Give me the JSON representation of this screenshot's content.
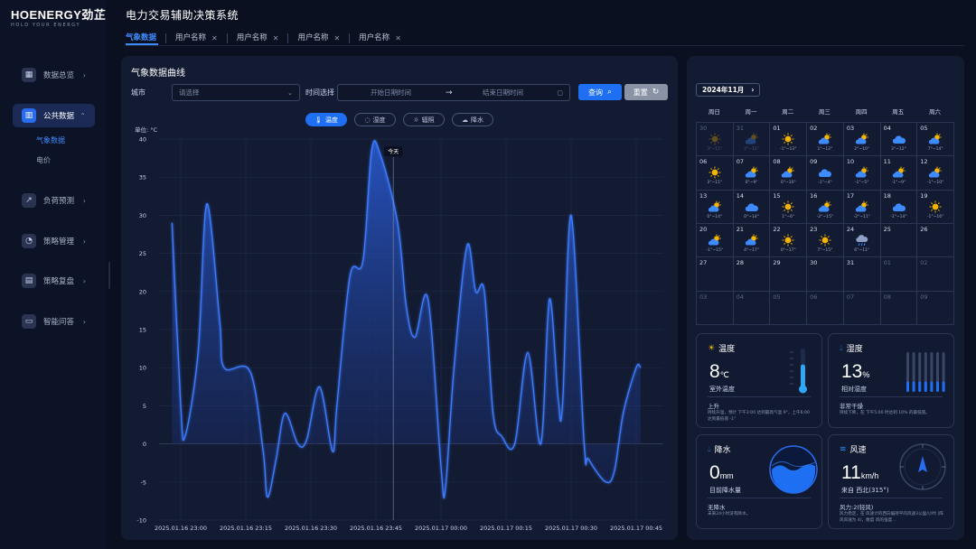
{
  "brand": {
    "name": "HOENERGY劲芷",
    "tagline": "HOLD YOUR ENERGY"
  },
  "app_title": "电力交易辅助决策系统",
  "sidebar": {
    "items": [
      {
        "label": "数据总览",
        "icon": "dashboard-icon",
        "chevron": "›"
      },
      {
        "label": "公共数据",
        "icon": "bar-chart-icon",
        "chevron": "⌃",
        "active": true,
        "children": [
          {
            "label": "气象数据",
            "active": true
          },
          {
            "label": "电价"
          }
        ]
      },
      {
        "label": "负荷预测",
        "icon": "trend-icon",
        "chevron": "›"
      },
      {
        "label": "策略管理",
        "icon": "pie-icon",
        "chevron": "›"
      },
      {
        "label": "策略复盘",
        "icon": "document-icon",
        "chevron": "›"
      },
      {
        "label": "智能问答",
        "icon": "chat-icon",
        "chevron": "›"
      }
    ]
  },
  "tabs": [
    {
      "label": "气象数据",
      "closable": false
    },
    {
      "label": "用户名称",
      "closable": true
    },
    {
      "label": "用户名称",
      "closable": true
    },
    {
      "label": "用户名称",
      "closable": true
    },
    {
      "label": "用户名称",
      "closable": true
    }
  ],
  "chart_panel": {
    "title": "气象数据曲线",
    "city_label": "城市",
    "city_placeholder": "请选择",
    "time_label": "时间选择",
    "start_placeholder": "开始日期时间",
    "end_placeholder": "结束日期时间",
    "query_label": "查询",
    "reset_label": "重置",
    "toggles": [
      {
        "label": "温度",
        "active": true
      },
      {
        "label": "湿度",
        "active": false
      },
      {
        "label": "辐照",
        "active": false
      },
      {
        "label": "降水",
        "active": false
      }
    ]
  },
  "chart_data": {
    "type": "area",
    "unit_label": "单位: °C",
    "ylim": [
      -10,
      40
    ],
    "y_ticks": [
      -10,
      -5,
      0,
      5,
      10,
      15,
      20,
      25,
      30,
      35,
      40
    ],
    "x_tick_labels": [
      "2025.01.16 23:00",
      "2025.01.16 23:15",
      "2025.01.16 23:30",
      "2025.01.16 23:45",
      "2025.01.17 00:00",
      "2025.01.17 00:15",
      "2025.01.17 00:30",
      "2025.01.17 00:45"
    ],
    "today_marker": {
      "label": "今天",
      "x": "2025.01.16 23:49"
    },
    "series": [
      {
        "values": [
          [
            "2025.01.16 22:58",
            29
          ],
          [
            "2025.01.16 23:00",
            5
          ],
          [
            "2025.01.16 23:01",
            1
          ],
          [
            "2025.01.16 23:04",
            12
          ],
          [
            "2025.01.16 23:06",
            31.5
          ],
          [
            "2025.01.16 23:09",
            16
          ],
          [
            "2025.01.16 23:10",
            10
          ],
          [
            "2025.01.16 23:16",
            9.5
          ],
          [
            "2025.01.16 23:19",
            -1
          ],
          [
            "2025.01.16 23:20",
            -7
          ],
          [
            "2025.01.16 23:22",
            -2
          ],
          [
            "2025.01.16 23:24",
            4
          ],
          [
            "2025.01.16 23:27",
            0
          ],
          [
            "2025.01.16 23:29",
            0.5
          ],
          [
            "2025.01.16 23:32",
            7.5
          ],
          [
            "2025.01.16 23:35",
            -1
          ],
          [
            "2025.01.16 23:36",
            5
          ],
          [
            "2025.01.16 23:39",
            22
          ],
          [
            "2025.01.16 23:42",
            24
          ],
          [
            "2025.01.16 23:44",
            38.5
          ],
          [
            "2025.01.16 23:46",
            38
          ],
          [
            "2025.01.16 23:50",
            29
          ],
          [
            "2025.01.16 23:52",
            18
          ],
          [
            "2025.01.16 23:54",
            14
          ],
          [
            "2025.01.16 23:57",
            19
          ],
          [
            "2025.01.17 00:00",
            -3
          ],
          [
            "2025.01.17 00:01",
            -6
          ],
          [
            "2025.01.17 00:03",
            10
          ],
          [
            "2025.01.17 00:06",
            26
          ],
          [
            "2025.01.17 00:08",
            20
          ],
          [
            "2025.01.17 00:10",
            20
          ],
          [
            "2025.01.17 00:12",
            4
          ],
          [
            "2025.01.17 00:14",
            1
          ],
          [
            "2025.01.17 00:17",
            0
          ],
          [
            "2025.01.17 00:20",
            12
          ],
          [
            "2025.01.17 00:23",
            0
          ],
          [
            "2025.01.17 00:25",
            19
          ],
          [
            "2025.01.17 00:27",
            6
          ],
          [
            "2025.01.17 00:28",
            5
          ],
          [
            "2025.01.17 00:30",
            30
          ],
          [
            "2025.01.17 00:33",
            0
          ],
          [
            "2025.01.17 00:34",
            -2
          ],
          [
            "2025.01.17 00:38",
            -5
          ],
          [
            "2025.01.17 00:40",
            -3.5
          ],
          [
            "2025.01.17 00:42",
            4
          ],
          [
            "2025.01.17 00:45",
            10
          ],
          [
            "2025.01.17 00:46",
            10
          ]
        ]
      }
    ]
  },
  "calendar": {
    "month_label": "2024年11月",
    "next_icon": "›",
    "weekdays": [
      "周日",
      "周一",
      "周二",
      "周三",
      "周四",
      "周五",
      "周六"
    ],
    "days": [
      {
        "d": "30",
        "other": true,
        "icon": "sun",
        "t": "3°~15°"
      },
      {
        "d": "31",
        "other": true,
        "icon": "partly",
        "t": "2°~12°"
      },
      {
        "d": "01",
        "icon": "sun",
        "t": "-1°~13°"
      },
      {
        "d": "02",
        "icon": "partly",
        "t": "1°~12°"
      },
      {
        "d": "03",
        "icon": "partly",
        "t": "2°~10°"
      },
      {
        "d": "04",
        "icon": "cloud",
        "t": "3°~12°"
      },
      {
        "d": "05",
        "icon": "partly",
        "t": "7°~14°"
      },
      {
        "d": "06",
        "icon": "sun",
        "t": "3°~11°"
      },
      {
        "d": "07",
        "icon": "partly",
        "t": "0°~9°"
      },
      {
        "d": "08",
        "icon": "partly",
        "t": "0°~10°"
      },
      {
        "d": "09",
        "icon": "cloud",
        "t": "-1°~4°"
      },
      {
        "d": "10",
        "icon": "partly",
        "t": "-1°~5°"
      },
      {
        "d": "11",
        "icon": "partly",
        "t": "-1°~9°"
      },
      {
        "d": "12",
        "icon": "partly",
        "t": "-1°~10°"
      },
      {
        "d": "13",
        "icon": "partly",
        "t": "0°~14°"
      },
      {
        "d": "14",
        "icon": "cloud",
        "t": "0°~14°"
      },
      {
        "d": "15",
        "icon": "sun",
        "t": "1°~6°"
      },
      {
        "d": "16",
        "icon": "partly",
        "t": "-2°~15°"
      },
      {
        "d": "17",
        "icon": "partly",
        "t": "-2°~11°"
      },
      {
        "d": "18",
        "icon": "cloud",
        "t": "-1°~14°"
      },
      {
        "d": "19",
        "icon": "sun",
        "t": "-1°~16°"
      },
      {
        "d": "20",
        "icon": "partly",
        "t": "-1°~15°"
      },
      {
        "d": "21",
        "icon": "partly",
        "t": "4°~17°"
      },
      {
        "d": "22",
        "icon": "sun",
        "t": "0°~17°"
      },
      {
        "d": "23",
        "icon": "sun",
        "t": "7°~15°"
      },
      {
        "d": "24",
        "icon": "rain",
        "t": "6°~11°"
      },
      {
        "d": "25"
      },
      {
        "d": "26"
      },
      {
        "d": "27"
      },
      {
        "d": "28"
      },
      {
        "d": "29"
      },
      {
        "d": "30"
      },
      {
        "d": "31"
      },
      {
        "d": "01",
        "other": true
      },
      {
        "d": "02",
        "other": true
      },
      {
        "d": "03",
        "other": true
      },
      {
        "d": "04",
        "other": true
      },
      {
        "d": "05",
        "other": true
      },
      {
        "d": "06",
        "other": true
      },
      {
        "d": "07",
        "other": true
      },
      {
        "d": "08",
        "other": true
      },
      {
        "d": "09",
        "other": true
      }
    ]
  },
  "cards": {
    "temperature": {
      "title": "温度",
      "value": "8",
      "unit": "℃",
      "label": "室外温度",
      "status": "上升",
      "desc": "持续升温，预计 下午3:00 达到最高气温 9°，上午6:00 达到最低值 -1°",
      "level": 0.6
    },
    "humidity": {
      "title": "湿度",
      "value": "13",
      "unit": "%",
      "label": "相对湿度",
      "status": "非常干燥",
      "desc": "持续下降，在 下午5:00 时达到 10% 的最低值。",
      "level": 0.13
    },
    "precipitation": {
      "title": "降水",
      "value": "0",
      "unit": "mm",
      "label": "目前降水量",
      "status": "无降水",
      "desc": "未来24小时没有降水。"
    },
    "wind": {
      "title": "风速",
      "value": "11",
      "unit": "km/h",
      "label": "来自 西北(315°)",
      "status": "风力:2(轻风)",
      "desc": "风力稳定，在 风速计的西向偏持平的风速3公里/小时 (阵风风速为 4)，数度 风的强度…",
      "direction_deg": 315
    }
  },
  "colors": {
    "accent": "#1f6ff2",
    "line": "#3d7bff",
    "bg": "#0b1020",
    "panel": "#131b33"
  }
}
